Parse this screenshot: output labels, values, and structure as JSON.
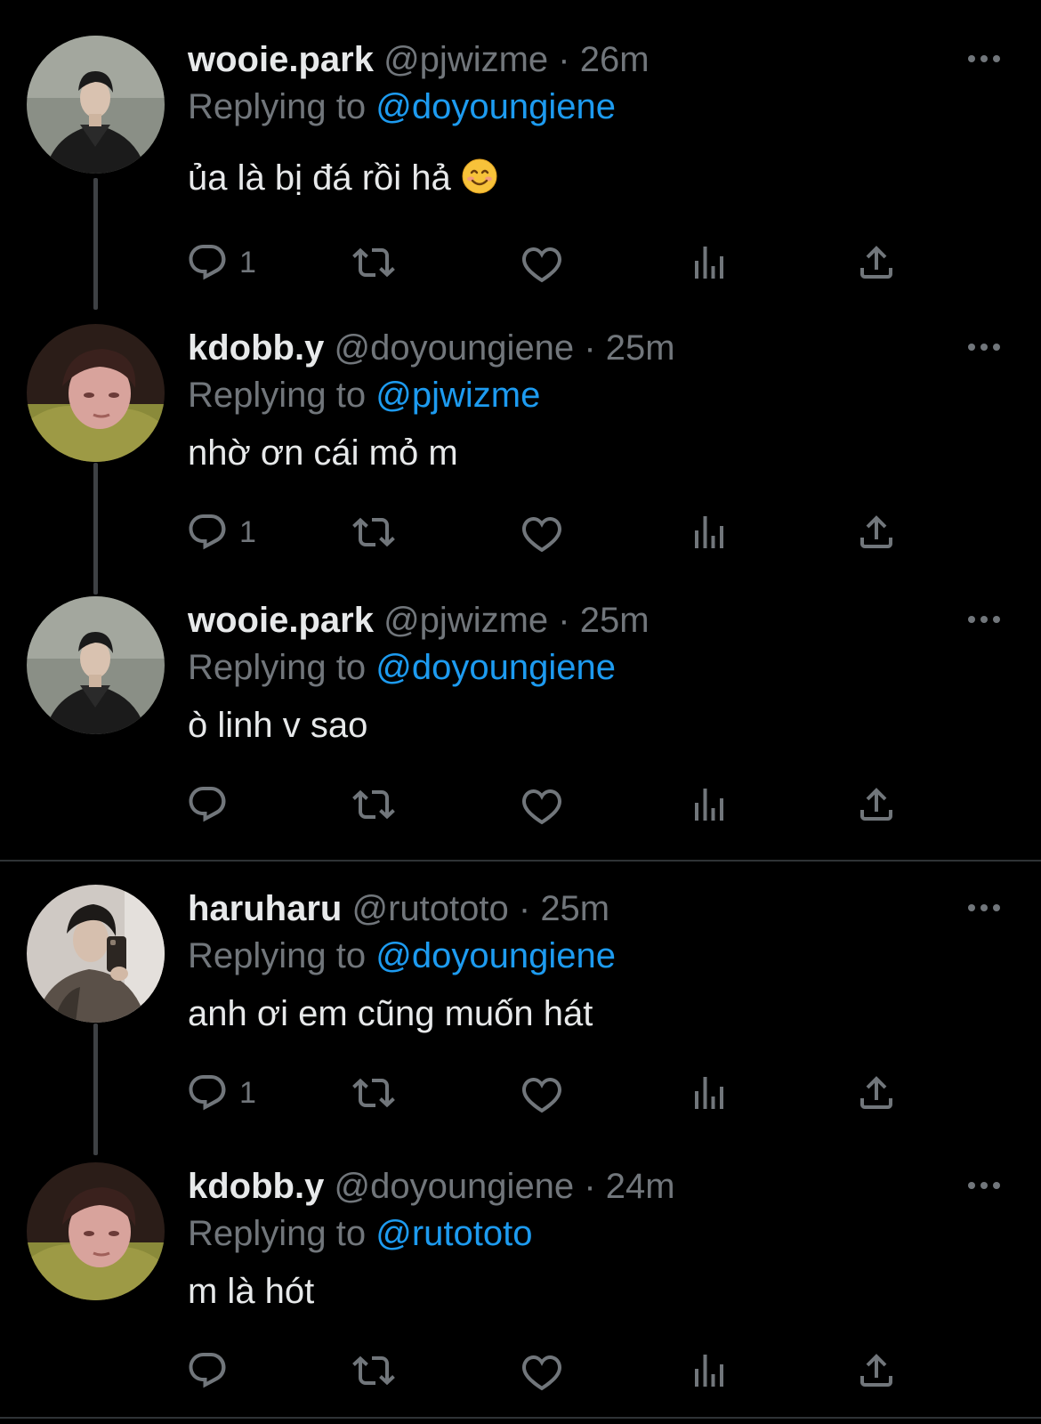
{
  "tweets": [
    {
      "display_name": "wooie.park",
      "handle": "@pjwizme",
      "time": "26m",
      "replying_prefix": "Replying to",
      "replying_to": "@doyoungiene",
      "text": "ủa là bị đá rồi hả",
      "emoji": "smiling-face-emoji",
      "reply_count": "1",
      "avatar": "avatar-wooie"
    },
    {
      "display_name": "kdobb.y",
      "handle": "@doyoungiene",
      "time": "25m",
      "replying_prefix": "Replying to",
      "replying_to": "@pjwizme",
      "text": "nhờ ơn cái mỏ m",
      "reply_count": "1",
      "avatar": "avatar-kdobby"
    },
    {
      "display_name": "wooie.park",
      "handle": "@pjwizme",
      "time": "25m",
      "replying_prefix": "Replying to",
      "replying_to": "@doyoungiene",
      "text": "ò linh v sao",
      "reply_count": "",
      "avatar": "avatar-wooie"
    },
    {
      "display_name": "haruharu",
      "handle": "@rutototo",
      "time": "25m",
      "replying_prefix": "Replying to",
      "replying_to": "@doyoungiene",
      "text": "anh ơi em cũng muốn hát",
      "reply_count": "1",
      "avatar": "avatar-haruharu"
    },
    {
      "display_name": "kdobb.y",
      "handle": "@doyoungiene",
      "time": "24m",
      "replying_prefix": "Replying to",
      "replying_to": "@rutototo",
      "text": "m là hót",
      "reply_count": "",
      "avatar": "avatar-kdobby"
    }
  ],
  "separator": "·",
  "icons": {
    "reply": "reply-icon",
    "retweet": "retweet-icon",
    "like": "heart-icon",
    "views": "views-icon",
    "share": "share-icon",
    "more": "more-icon"
  },
  "colors": {
    "background": "#000000",
    "text_primary": "#e7e9ea",
    "text_secondary": "#71767b",
    "accent": "#1d9bf0",
    "thread_line": "#3e4144",
    "divider": "#2f3336"
  }
}
